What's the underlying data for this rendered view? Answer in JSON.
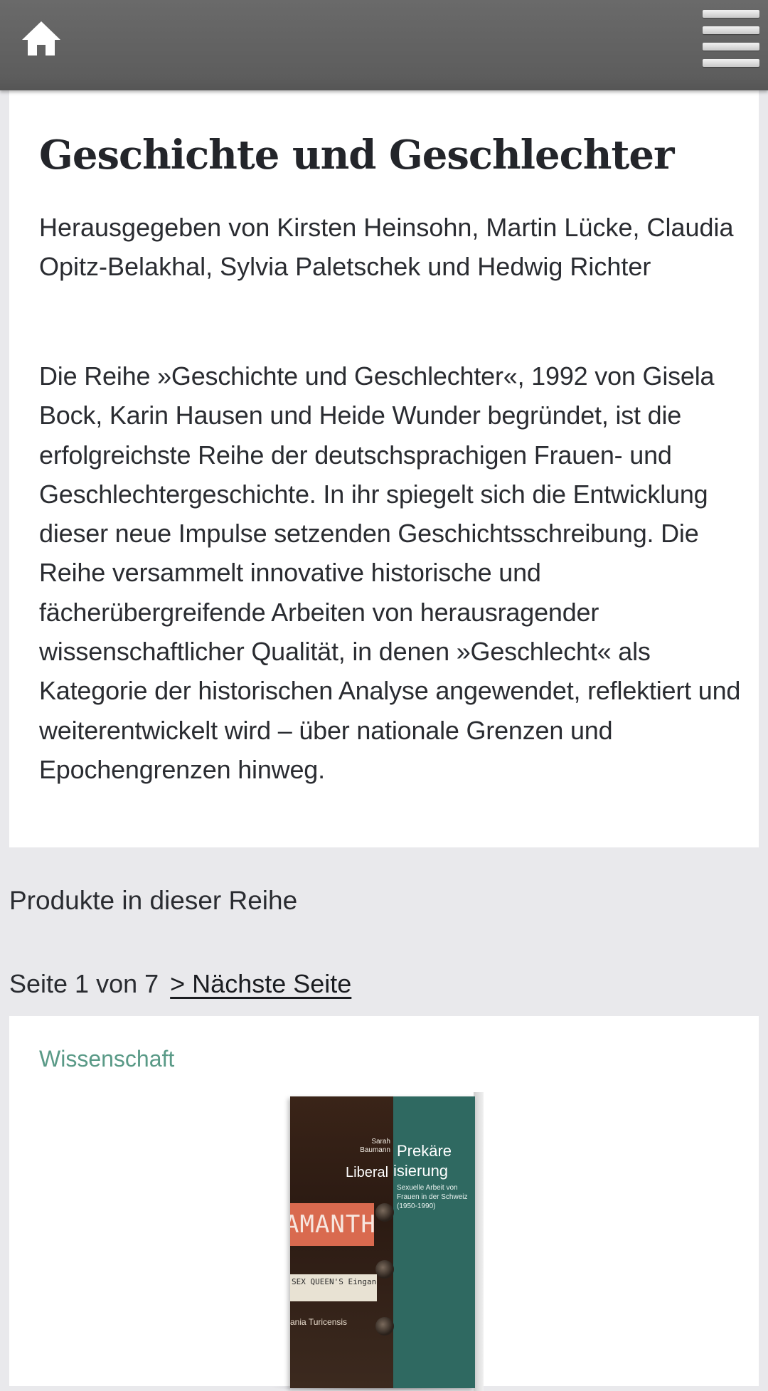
{
  "header": {
    "home_icon": "home-icon",
    "menu_icon": "hamburger-menu-icon",
    "background": "#616161"
  },
  "intro": {
    "title": "Geschichte und Geschlechter",
    "editors": "Herausgegeben von Kirsten Heinsohn, Martin Lücke, Claudia Opitz-Belakhal, Sylvia Paletschek und Hedwig Richter",
    "description": "Die Reihe »Geschichte und Geschlechter«, 1992 von Gisela Bock, Karin Hausen und Heide Wunder begründet, ist die erfolgreichste Reihe der deutschsprachigen Frauen- und Geschlechtergeschichte. In ihr spiegelt sich die Entwicklung dieser neue Impulse setzenden Geschichtsschreibung. Die Reihe versammelt innovative historische und fächerübergreifende Arbeiten von herausragender wissenschaftlicher Qualität, in denen »Geschlecht« als Kategorie der historischen Analyse angewendet, reflektiert und weiterentwickelt wird – über nationale Grenzen und Epochengrenzen hinweg."
  },
  "products": {
    "heading": "Produkte in dieser Reihe",
    "pagination": {
      "status": "Seite 1 von 7",
      "next_label": "> Nächste Seite"
    },
    "items": [
      {
        "category": "Wissenschaft",
        "category_color": "#5a9a87",
        "cover": {
          "author": "Sarah Baumann",
          "title_right_1": "Prekäre",
          "title_left": "Liberal",
          "title_right_2": "isierung",
          "subtitle": "Sexuelle Arbeit von Frauen in der Schweiz (1950-1990)",
          "sign_text": "AMANTHA",
          "plaque_text": "SEX QUEEN'S Eingang Nebenan",
          "series_text": "ania Turicensis",
          "accent_color": "#2f6961"
        }
      }
    ]
  }
}
